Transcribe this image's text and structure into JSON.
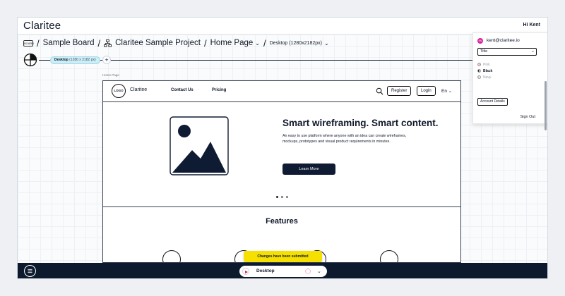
{
  "app": {
    "logo": "Claritee",
    "greeting": "Hi Kent"
  },
  "breadcrumb": {
    "board_icon_text": "BOARD",
    "board": "Sample Board",
    "project": "Claritee Sample Project",
    "page": "Home Page",
    "viewport": "Desktop (1280x2182px)",
    "separator": "/"
  },
  "viewport_bar": {
    "chip_name": "Desktop",
    "chip_size": "(1280 x 2182 px)",
    "add_label": "+"
  },
  "frame": {
    "label": "Home Page",
    "nav": {
      "logo": "LOGO",
      "brand": "Claritee",
      "links": [
        "Contact Us",
        "Pricing"
      ],
      "register": "Register",
      "login": "Login",
      "language": "En"
    },
    "hero": {
      "title": "Smart wireframing. Smart content.",
      "body": "An easy to use platform where anyone with an idea can create wireframes, mockups, prototypes and visual product requirements in minutes.",
      "cta": "Learn More"
    },
    "carousel": {
      "count": 3,
      "active": 1
    },
    "features_title": "Features"
  },
  "popover": {
    "avatar_initials": "KN",
    "email": "kent@claritee.io",
    "select_value": "Title",
    "swatches": [
      {
        "label": "Pink",
        "color": "#f4c7d6"
      },
      {
        "label": "Black",
        "color": "#111111"
      },
      {
        "label": "Navy",
        "color": "#cbd5e1"
      }
    ],
    "account_button": "Account Details",
    "sign_out": "Sign Out"
  },
  "toast": {
    "message": "Changes have been submitted"
  },
  "bottom": {
    "viewport_name": "Desktop"
  },
  "colors": {
    "navy": "#0d1a2e",
    "toast": "#f5e000",
    "chip": "#cdeef7",
    "accent": "#d6249f"
  }
}
